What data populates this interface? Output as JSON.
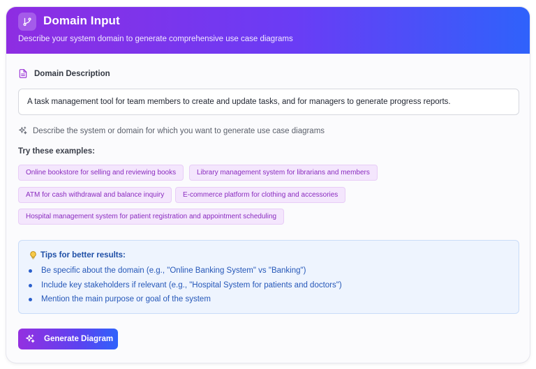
{
  "header": {
    "title": "Domain Input",
    "subtitle": "Describe your system domain to generate comprehensive use case diagrams",
    "icon": "git-branch-icon"
  },
  "description": {
    "label": "Domain Description",
    "label_icon": "document-icon",
    "value": "A task management tool for team members to create and update tasks, and for managers to generate progress reports.",
    "hint": "Describe the system or domain for which you want to generate use case diagrams",
    "hint_icon": "sparkles-icon"
  },
  "examples": {
    "title": "Try these examples:",
    "items": [
      "Online bookstore for selling and reviewing books",
      "Library management system for librarians and members",
      "ATM for cash withdrawal and balance inquiry",
      "E-commerce platform for clothing and accessories",
      "Hospital management system for patient registration and appointment scheduling"
    ]
  },
  "tips": {
    "title": "Tips for better results:",
    "icon": "lightbulb-icon",
    "items": [
      "Be specific about the domain (e.g., \"Online Banking System\" vs \"Banking\")",
      "Include key stakeholders if relevant (e.g., \"Hospital System for patients and doctors\")",
      "Mention the main purpose or goal of the system"
    ]
  },
  "action": {
    "generate_label": "Generate Diagram",
    "icon": "sparkles-icon"
  },
  "colors": {
    "header_gradient_start": "#8e2de2",
    "header_gradient_end": "#2f62fb",
    "chip_bg": "#f4e6fd",
    "chip_text": "#8a2bbf",
    "tips_bg": "#eef4fe",
    "tips_text": "#2557b8"
  }
}
